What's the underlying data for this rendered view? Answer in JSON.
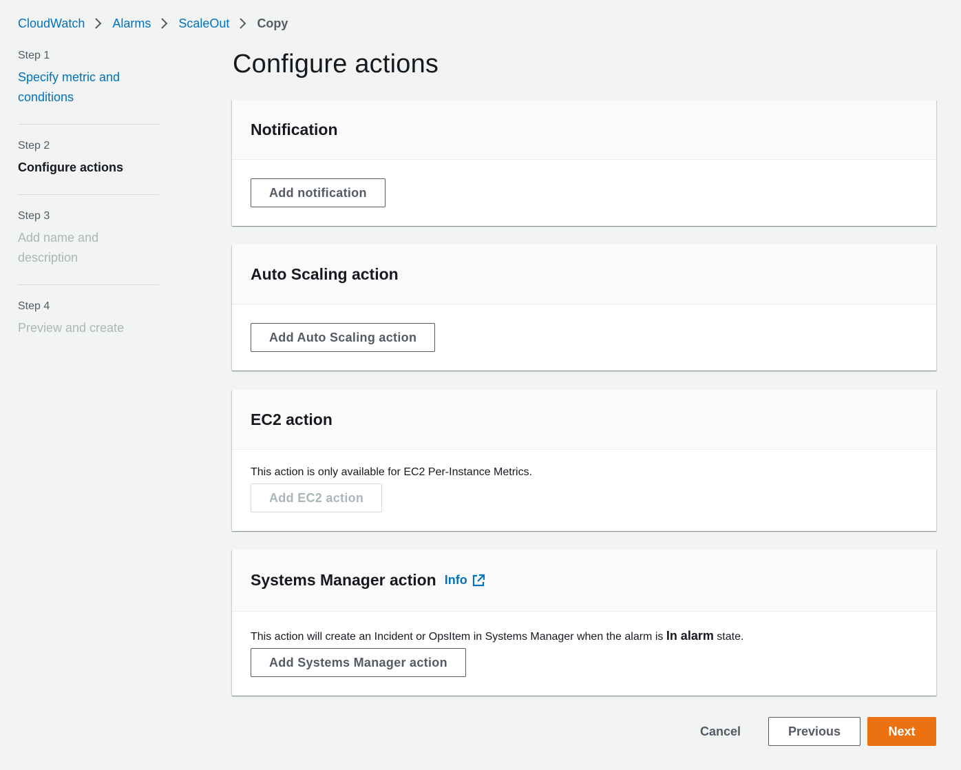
{
  "breadcrumb": {
    "items": [
      "CloudWatch",
      "Alarms",
      "ScaleOut"
    ],
    "current": "Copy"
  },
  "steps": [
    {
      "num": "Step 1",
      "title": "Specify metric and conditions",
      "state": "link"
    },
    {
      "num": "Step 2",
      "title": "Configure actions",
      "state": "active"
    },
    {
      "num": "Step 3",
      "title": "Add name and description",
      "state": "disabled"
    },
    {
      "num": "Step 4",
      "title": "Preview and create",
      "state": "disabled"
    }
  ],
  "page_title": "Configure actions",
  "panels": {
    "notification": {
      "title": "Notification",
      "button": "Add notification"
    },
    "autoscaling": {
      "title": "Auto Scaling action",
      "button": "Add Auto Scaling action"
    },
    "ec2": {
      "title": "EC2 action",
      "description": "This action is only available for EC2 Per-Instance Metrics.",
      "button": "Add EC2 action"
    },
    "ssm": {
      "title": "Systems Manager action",
      "info": "Info",
      "description_pre": "This action will create an Incident or OpsItem in Systems Manager when the alarm is ",
      "description_bold": "In alarm",
      "description_post": " state.",
      "button": "Add Systems Manager action"
    }
  },
  "footer": {
    "cancel": "Cancel",
    "previous": "Previous",
    "next": "Next"
  },
  "colors": {
    "link": "#0073bb",
    "primary": "#ec7211",
    "background": "#f2f3f3"
  }
}
